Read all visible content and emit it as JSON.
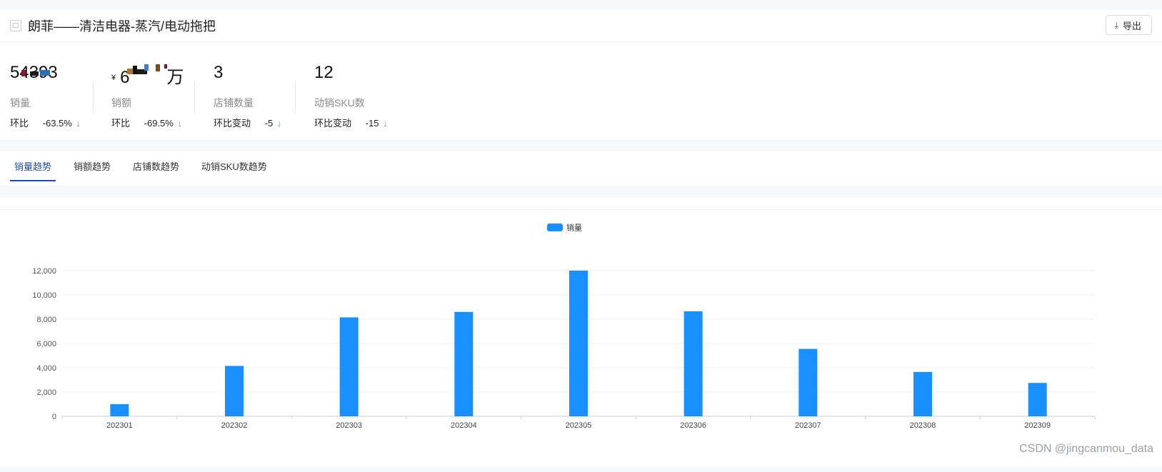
{
  "header": {
    "title": "朗菲——清洁电器-蒸汽/电动拖把",
    "export_label": "导出"
  },
  "metrics": [
    {
      "value": "54393",
      "label": "销量",
      "change_label": "环比",
      "change_value": "-63.5%"
    },
    {
      "currency": "¥",
      "value": "6",
      "unit": "万",
      "label": "销额",
      "change_label": "环比",
      "change_value": "-69.5%"
    },
    {
      "value": "3",
      "label": "店铺数量",
      "change_label": "环比变动",
      "change_value": "-5"
    },
    {
      "value": "12",
      "label": "动销SKU数",
      "change_label": "环比变动",
      "change_value": "-15"
    }
  ],
  "tabs": [
    {
      "label": "销量趋势",
      "active": true
    },
    {
      "label": "销额趋势",
      "active": false
    },
    {
      "label": "店铺数趋势",
      "active": false
    },
    {
      "label": "动销SKU数趋势",
      "active": false
    }
  ],
  "colors": {
    "accent": "#1890ff",
    "tab_active": "#1d4fa0",
    "down_arrow": "#33c27a"
  },
  "chart_data": {
    "type": "bar",
    "categories": [
      "202301",
      "202302",
      "202303",
      "202304",
      "202305",
      "202306",
      "202307",
      "202308",
      "202309"
    ],
    "series": [
      {
        "name": "销量",
        "values": [
          1000,
          4150,
          8150,
          8600,
          12000,
          8650,
          5550,
          3650,
          2750
        ],
        "color": "#1890ff"
      }
    ],
    "yticks": [
      0,
      2000,
      4000,
      6000,
      8000,
      10000,
      12000
    ],
    "ylim": [
      0,
      12000
    ],
    "legend_position": "top-center",
    "grid": true
  },
  "watermark": "CSDN @jingcanmou_data"
}
